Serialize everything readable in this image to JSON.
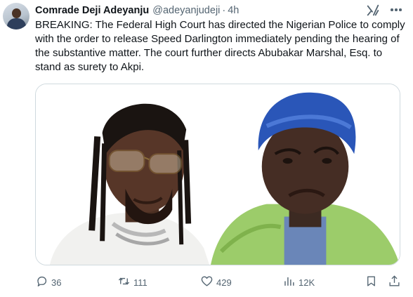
{
  "tweet": {
    "author_name": "Comrade Deji Adeyanju",
    "handle": "@adeyanjudeji",
    "separator": "·",
    "time": "4h",
    "text": "BREAKING: The Federal High Court has directed the Nigerian Police to comply with the order to release Speed Darlington immediately pending the hearing of the substantive matter. The court further directs Abubakar Marshal, Esq. to stand as surety to Akpi.",
    "media_description": "Side-by-side photo of two men"
  },
  "actions": {
    "replies": "36",
    "reposts": "111",
    "likes": "429",
    "views": "12K"
  },
  "icons": [
    "grok-icon",
    "more-icon",
    "reply-icon",
    "repost-icon",
    "like-icon",
    "views-icon",
    "bookmark-icon",
    "share-icon"
  ],
  "colors": {
    "text_primary": "#0f1419",
    "text_secondary": "#536471",
    "border": "#cfd9de"
  }
}
